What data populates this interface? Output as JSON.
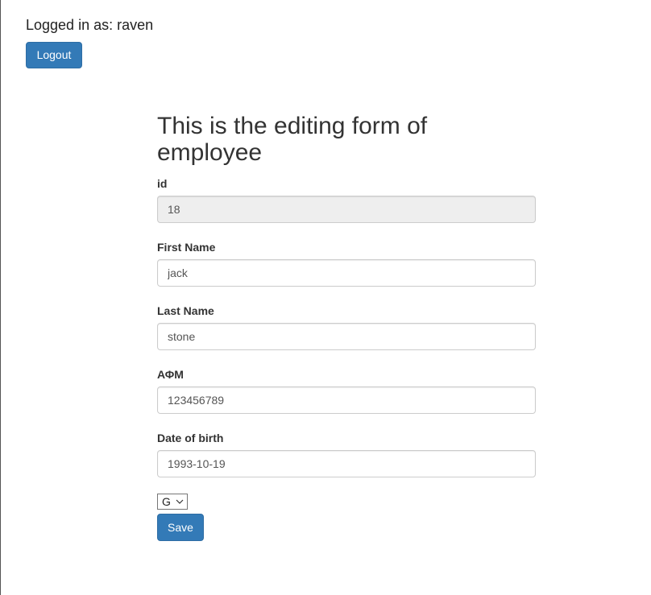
{
  "header": {
    "login_status": "Logged in as: raven",
    "logout_label": "Logout"
  },
  "form": {
    "title": "This is the editing form of employee",
    "fields": [
      {
        "label": "id",
        "value": "18",
        "readonly": true
      },
      {
        "label": "First Name",
        "value": "jack"
      },
      {
        "label": "Last Name",
        "value": "stone"
      },
      {
        "label": "ΑΦΜ",
        "value": "123456789"
      },
      {
        "label": "Date of birth",
        "value": "1993-10-19"
      }
    ],
    "select": {
      "selected": "G",
      "icon": "chevron-down-icon"
    },
    "save_label": "Save"
  },
  "colors": {
    "primary": "#337ab7",
    "readonly_bg": "#eeeeee",
    "border": "#cccccc"
  }
}
